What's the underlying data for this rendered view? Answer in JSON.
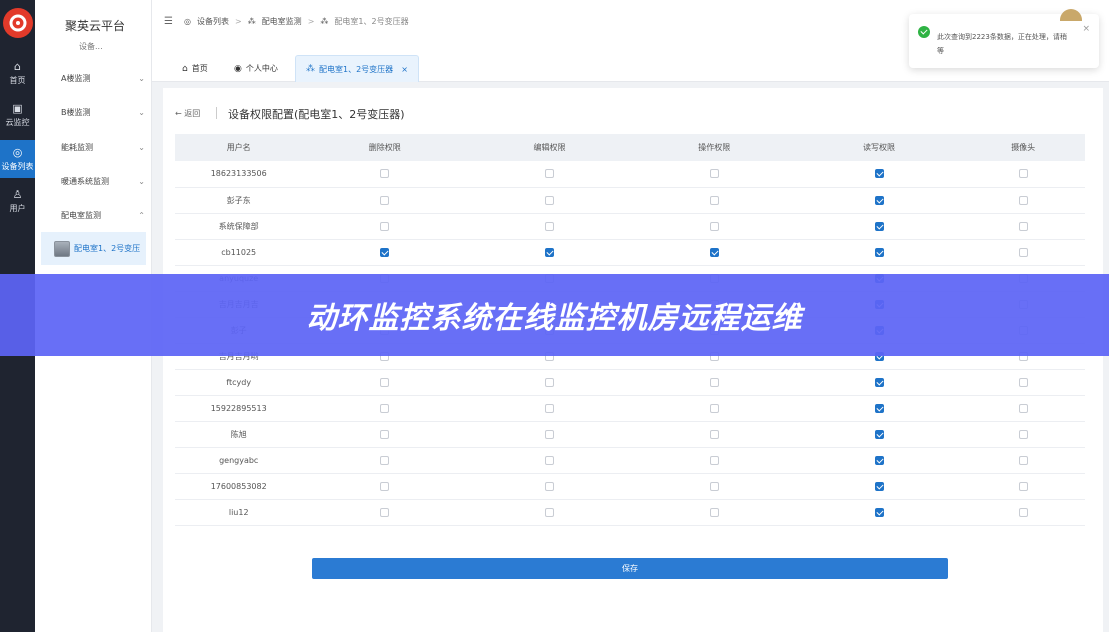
{
  "rail": {
    "items": [
      {
        "label": "首页",
        "icon": "home-icon",
        "glyph": "⌂"
      },
      {
        "label": "云监控",
        "icon": "monitor-icon",
        "glyph": "▣"
      },
      {
        "label": "设备列表",
        "icon": "device-list-icon",
        "glyph": "◎"
      },
      {
        "label": "用户",
        "icon": "user-icon",
        "glyph": "♙"
      }
    ]
  },
  "nav": {
    "title": "聚英云平台",
    "subtitle": "设备...",
    "groups": [
      "A楼监测",
      "B楼监测",
      "能耗监测",
      "暖通系统监测",
      "配电室监测"
    ],
    "active_leaf": "配电室1、2号变压"
  },
  "breadcrumb": {
    "items": [
      "设备列表",
      "配电室监测",
      "配电室1、2号变压器"
    ]
  },
  "tabs": {
    "home": "首页",
    "profile": "个人中心",
    "current": "配电室1、2号变压器"
  },
  "panel": {
    "back_label": "返回",
    "title": "设备权限配置(配电室1、2号变压器)",
    "save_label": "保存"
  },
  "table": {
    "columns": [
      "用户名",
      "删除权限",
      "编辑权限",
      "操作权限",
      "读写权限",
      "摄像头"
    ],
    "rows": [
      {
        "user": "18623133506",
        "perms": [
          false,
          false,
          false,
          true,
          false
        ]
      },
      {
        "user": "彭子东",
        "perms": [
          false,
          false,
          false,
          true,
          false
        ]
      },
      {
        "user": "系统保障部",
        "perms": [
          false,
          false,
          false,
          true,
          false
        ]
      },
      {
        "user": "cb11025",
        "perms": [
          true,
          true,
          true,
          true,
          false
        ]
      },
      {
        "user": "anyuquze",
        "perms": [
          false,
          false,
          false,
          true,
          false
        ]
      },
      {
        "user": "吉月吉月吉",
        "perms": [
          false,
          false,
          false,
          true,
          false
        ]
      },
      {
        "user": "彭子",
        "perms": [
          false,
          false,
          false,
          true,
          false
        ]
      },
      {
        "user": "吉月吉月哟",
        "perms": [
          false,
          false,
          false,
          true,
          false
        ]
      },
      {
        "user": "ftcydy",
        "perms": [
          false,
          false,
          false,
          true,
          false
        ]
      },
      {
        "user": "15922895513",
        "perms": [
          false,
          false,
          false,
          true,
          false
        ]
      },
      {
        "user": "陈旭",
        "perms": [
          false,
          false,
          false,
          true,
          false
        ]
      },
      {
        "user": "gengyabc",
        "perms": [
          false,
          false,
          false,
          true,
          false
        ]
      },
      {
        "user": "17600853082",
        "perms": [
          false,
          false,
          false,
          true,
          false
        ]
      },
      {
        "user": "liu12",
        "perms": [
          false,
          false,
          false,
          true,
          false
        ]
      }
    ]
  },
  "toast": {
    "message": "此次查询到2223条数据，正在处理，请稍等"
  },
  "banner": {
    "text": "动环监控系统在线监控机房远程运维"
  },
  "colors": {
    "accent": "#1e73c8",
    "rail_bg": "#1f2430",
    "banner": "#5c64f5",
    "success": "#2fb344"
  }
}
